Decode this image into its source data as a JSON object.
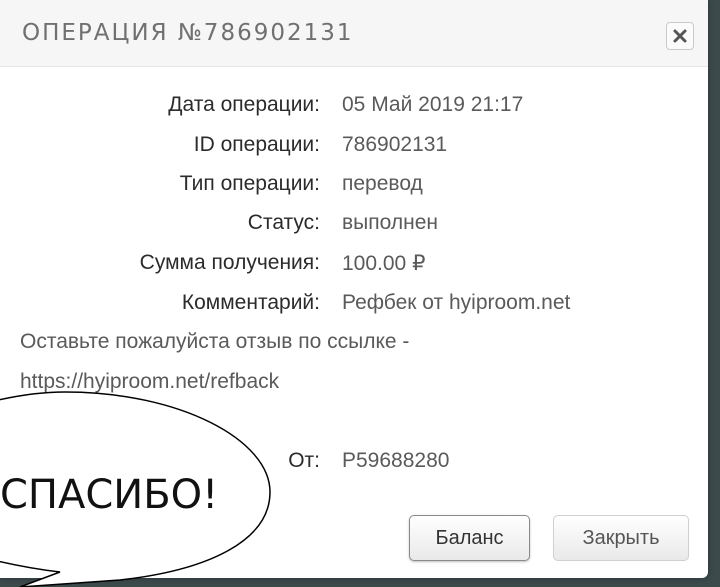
{
  "modal": {
    "title": "ОПЕРАЦИЯ №786902131",
    "close_icon": "close-icon"
  },
  "details": [
    {
      "label": "Дата операции:",
      "value": "05 Май 2019 21:17"
    },
    {
      "label": "ID операции:",
      "value": "786902131"
    },
    {
      "label": "Тип операции:",
      "value": "перевод"
    },
    {
      "label": "Статус:",
      "value": "выполнен"
    },
    {
      "label": "Сумма получения:",
      "value": "100.00 ₽"
    },
    {
      "label": "Комментарий:",
      "value": "Рефбек от hyiproom.net"
    }
  ],
  "comment_continued": {
    "line1": "Оставьте пожалуйста отзыв по ссылке -",
    "line2": "https://hyiproom.net/refback"
  },
  "from": {
    "label": "От:",
    "value": "P59688280"
  },
  "buttons": {
    "balance": "Баланс",
    "close": "Закрыть"
  },
  "overlay": {
    "speech_bubble_text": "СПАСИБО!"
  }
}
